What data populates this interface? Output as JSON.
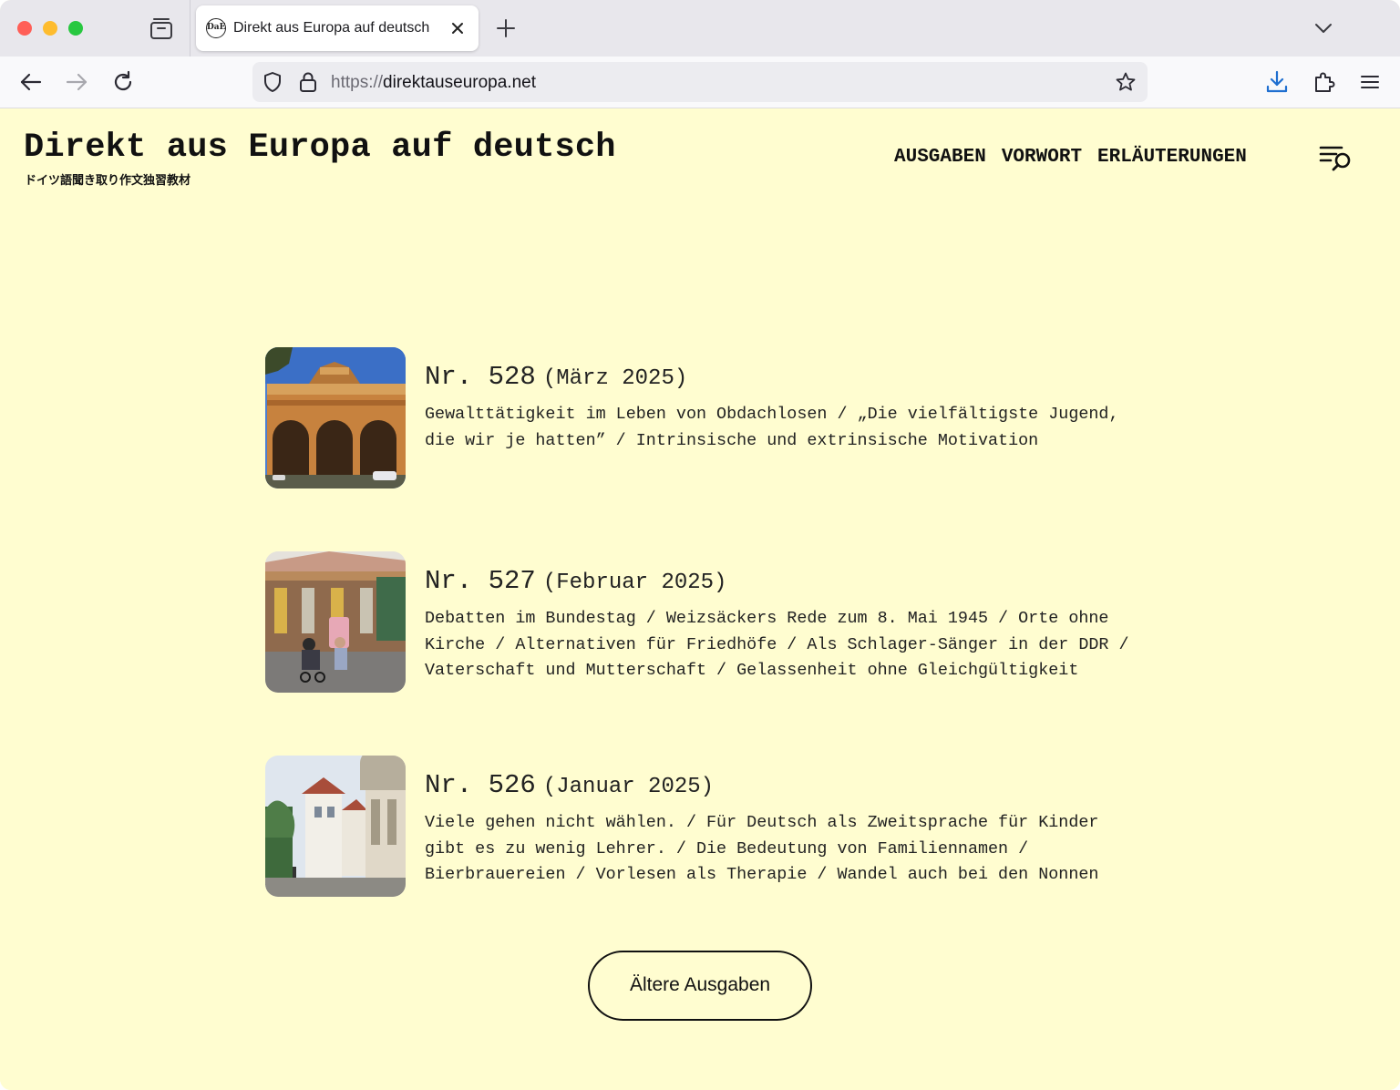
{
  "browser": {
    "tab_title": "Direkt aus Europa auf deutsch",
    "favicon_text": "DaE",
    "url_scheme": "https://",
    "url_host": "direktauseuropa.net"
  },
  "site": {
    "title": "Direkt aus Europa auf deutsch",
    "subtitle": "ドイツ語聞き取り作文独習教材"
  },
  "nav": {
    "items": [
      "AUSGABEN",
      "VORWORT",
      "ERLÄUTERUNGEN"
    ]
  },
  "issues": [
    {
      "number": "Nr. 528",
      "date": "(März 2025)",
      "description": "Gewalttätigkeit im Leben von Obdachlosen / „Die vielfältigste Jugend, die wir je hatten” / Intrinsische und extrinsische Motivation"
    },
    {
      "number": "Nr. 527",
      "date": "(Februar 2025)",
      "description": "Debatten im Bundestag / Weizsäckers Rede zum 8. Mai 1945 / Orte ohne Kirche / Alternativen für Friedhöfe / Als Schlager-Sänger in der DDR / Vaterschaft und Mutterschaft / Gelassenheit ohne Gleichgültigkeit"
    },
    {
      "number": "Nr. 526",
      "date": "(Januar 2025)",
      "description": "Viele gehen nicht wählen. / Für Deutsch als Zweitsprache für Kinder gibt es zu wenig Lehrer. / Die Bedeutung von Familiennamen / Bierbrauereien / Vorlesen als Therapie / Wandel auch bei den Nonnen"
    }
  ],
  "older_button": "Ältere Ausgaben",
  "colors": {
    "page_background": "#fffdd0",
    "text": "#111111"
  }
}
